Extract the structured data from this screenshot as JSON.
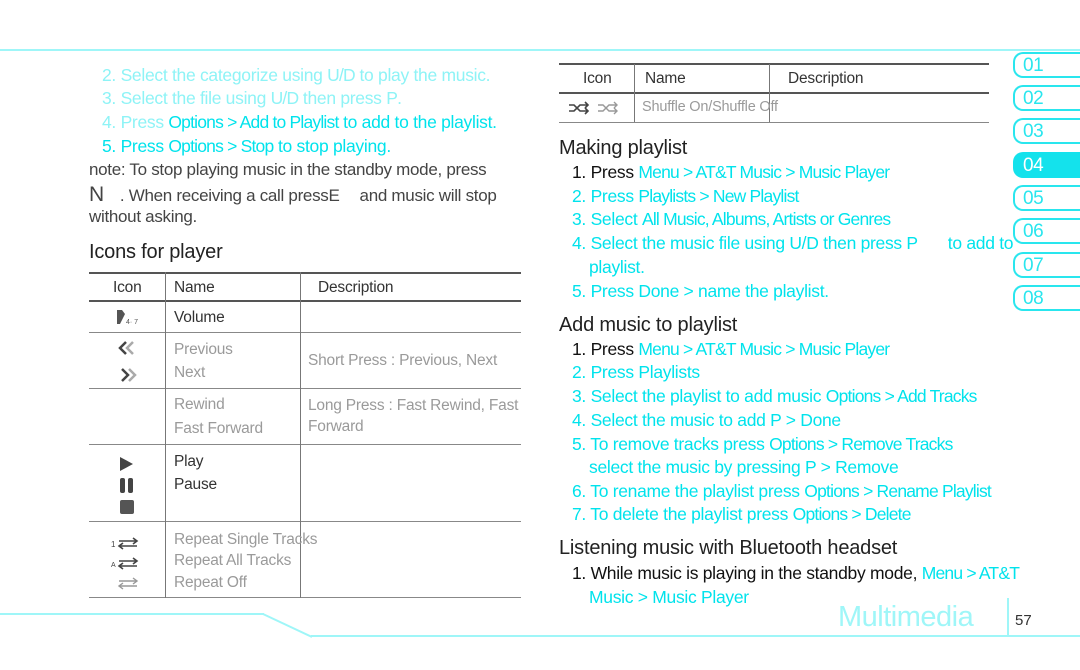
{
  "left": {
    "steps": [
      {
        "num": "2.",
        "text": "Select the categorize using ",
        "key": "U/D",
        "rest": " to play the music."
      },
      {
        "num": "3.",
        "text": "Select the file using ",
        "key": "U/D",
        "rest": " then press ",
        "key2": "P",
        "rest2": "."
      },
      {
        "num": "4.",
        "text": "Press ",
        "highlight": "Options > Add to Playlist",
        "rest": " to add to the playlist."
      },
      {
        "num": "5.",
        "text": "Press ",
        "highlight": "Options > Stop",
        "rest": " to stop playing."
      }
    ],
    "note": {
      "line1": "note:  To stop playing music in the standby mode, press",
      "key1": "N",
      "line2": ". When receiving a call press",
      "key2": "E",
      "line2b": "and music will stop",
      "line3": "without asking."
    },
    "icons_heading": "Icons for player",
    "table": {
      "headers": [
        "Icon",
        "Name",
        "Description"
      ],
      "rows": [
        {
          "icon": "volume-icon",
          "names": [
            "Volume"
          ],
          "description": ""
        },
        {
          "icon": "previous-next-icon",
          "names": [
            "Previous",
            "Next"
          ],
          "description": "Short Press : Previous, Next"
        },
        {
          "icon": "",
          "names": [
            "Rewind",
            "Fast Forward"
          ],
          "description": "Long Press : Fast Rewind, Fast Forward",
          "description_lines": [
            "Long Press : Fast Rewind, Fast",
            "Forward"
          ]
        },
        {
          "icon": "play-pause-stop-icon",
          "names": [
            "Play",
            "Pause"
          ],
          "description": ""
        },
        {
          "icon": "repeat-icon",
          "names": [
            "Repeat Single Tracks",
            "Repeat All Tracks",
            "Repeat Off"
          ],
          "description": ""
        }
      ]
    }
  },
  "right": {
    "table": {
      "headers": [
        "Icon",
        "Name",
        "Description"
      ],
      "rows": [
        {
          "icon": "shuffle-icon",
          "name": "Shuffle On/Shuffle Off",
          "description": ""
        }
      ]
    },
    "making_playlist": {
      "heading": "Making playlist",
      "steps": [
        {
          "num": "1.",
          "text": "Press ",
          "highlight": "Menu > AT&T Music > Music Player"
        },
        {
          "num": "2.",
          "text": "Press ",
          "highlight": "Playlists > New Playlist"
        },
        {
          "num": "3.",
          "text": "Select ",
          "highlight": "All Music, Albums, Artists or Genres"
        },
        {
          "num": "4.",
          "text": "Select the music file using U/D then press P",
          "rest": "to add to",
          "cont": "playlist."
        },
        {
          "num": "5.",
          "text": "Press ",
          "highlight": "Done > name the playlist."
        }
      ]
    },
    "add_music": {
      "heading": "Add music to playlist",
      "steps": [
        {
          "num": "1.",
          "text": "Press ",
          "highlight": "Menu > AT&T Music > Music Player"
        },
        {
          "num": "2.",
          "text": "Press ",
          "highlight": "Playlists"
        },
        {
          "num": "3.",
          "text": "Select the playlist to add music ",
          "highlight": "Options > Add Tracks"
        },
        {
          "num": "4.",
          "text": "Select the music to add P > Done"
        },
        {
          "num": "5.",
          "text": "To remove tracks press ",
          "highlight": "Options > Remove Tracks",
          "cont": "select the music by pressing P > Remove"
        },
        {
          "num": "6.",
          "text": "To rename the playlist press ",
          "highlight": "Options > Rename Playlist"
        },
        {
          "num": "7.",
          "text": "To delete the playlist press ",
          "highlight": "Options > Delete"
        }
      ]
    },
    "bluetooth": {
      "heading": "Listening music with Bluetooth headset",
      "steps": [
        {
          "num": "1.",
          "text": "While music is playing in the standby mode, ",
          "highlight": "Menu > AT&T",
          "cont": "Music > Music Player"
        }
      ]
    }
  },
  "chapter_tabs": [
    {
      "label": "01",
      "active": false
    },
    {
      "label": "02",
      "active": false
    },
    {
      "label": "03",
      "active": false
    },
    {
      "label": "04",
      "active": true
    },
    {
      "label": "05",
      "active": false
    },
    {
      "label": "06",
      "active": false
    },
    {
      "label": "07",
      "active": false
    },
    {
      "label": "08",
      "active": false
    }
  ],
  "footer": {
    "section": "Multimedia",
    "page_number": "57"
  },
  "colors": {
    "accent": "#00e3ec",
    "accent_light": "#8ef3f6",
    "rule": "#9ff6f8"
  }
}
